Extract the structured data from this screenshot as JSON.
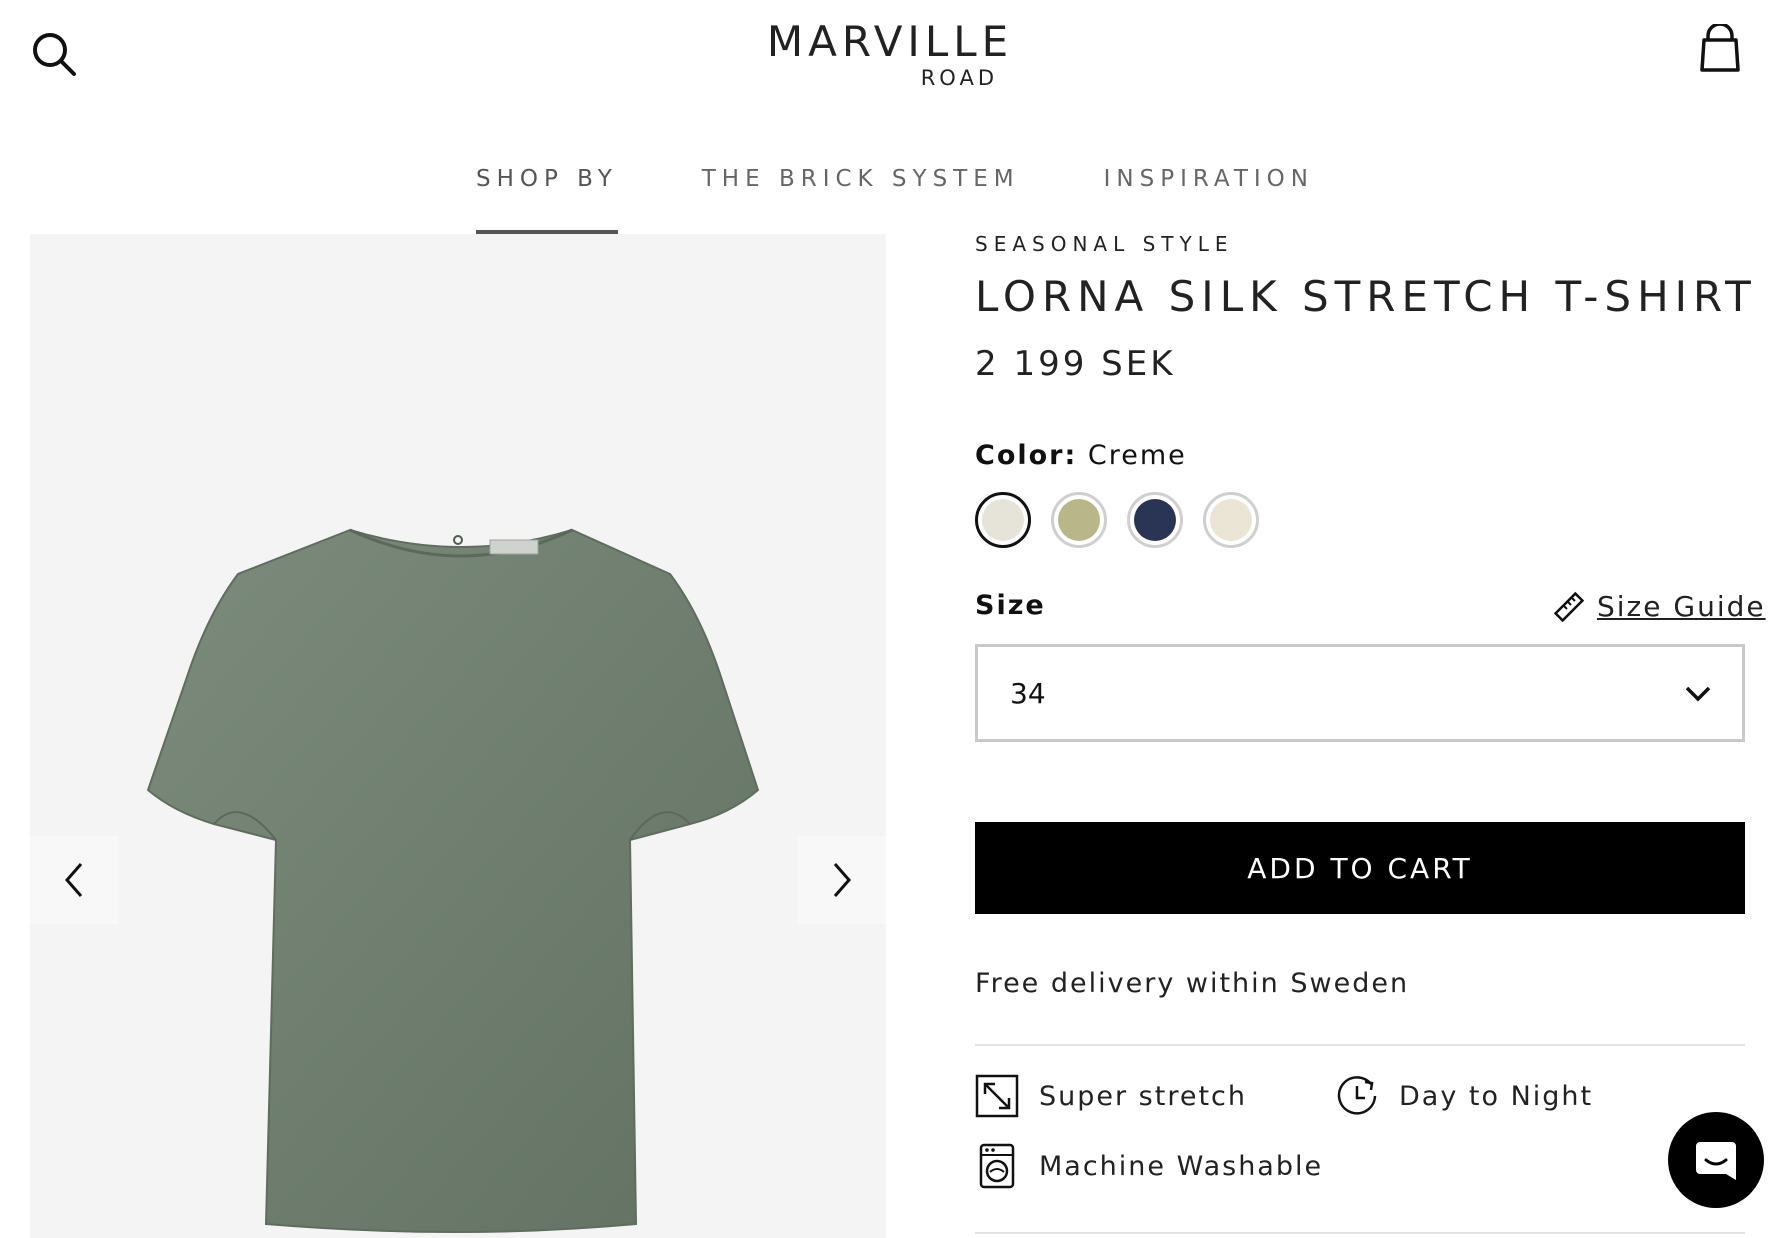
{
  "header": {
    "logo_main": "MARVILLE",
    "logo_sub": "ROAD",
    "search_icon": "search-icon",
    "cart_icon": "shopping-bag-icon"
  },
  "nav": {
    "items": [
      {
        "label": "SHOP BY",
        "active": true
      },
      {
        "label": "THE BRICK SYSTEM",
        "active": false
      },
      {
        "label": "INSPIRATION",
        "active": false
      }
    ]
  },
  "gallery": {
    "product_color": "#707f70",
    "prev_icon": "chevron-left-icon",
    "next_icon": "chevron-right-icon"
  },
  "product": {
    "collection": "SEASONAL STYLE",
    "name": "LORNA SILK STRETCH T-SHIRT",
    "price": "2 199 SEK",
    "color_label": "Color:",
    "color_value": "Creme",
    "swatches": [
      {
        "color": "#e6e4d8",
        "selected": true
      },
      {
        "color": "#b9b78a",
        "selected": false
      },
      {
        "color": "#2a3556",
        "selected": false
      },
      {
        "color": "#ebe5d6",
        "selected": false
      }
    ],
    "size_label": "Size",
    "size_guide_label": "Size Guide",
    "size_selected": "34",
    "add_to_cart_label": "ADD TO CART",
    "delivery_text": "Free delivery within Sweden",
    "features": [
      {
        "label": "Super stretch",
        "icon": "stretch-arrows-icon"
      },
      {
        "label": "Day to Night",
        "icon": "clock-icon"
      },
      {
        "label": "Machine Washable",
        "icon": "washing-machine-icon"
      }
    ]
  },
  "chat": {
    "icon": "chat-icon"
  }
}
